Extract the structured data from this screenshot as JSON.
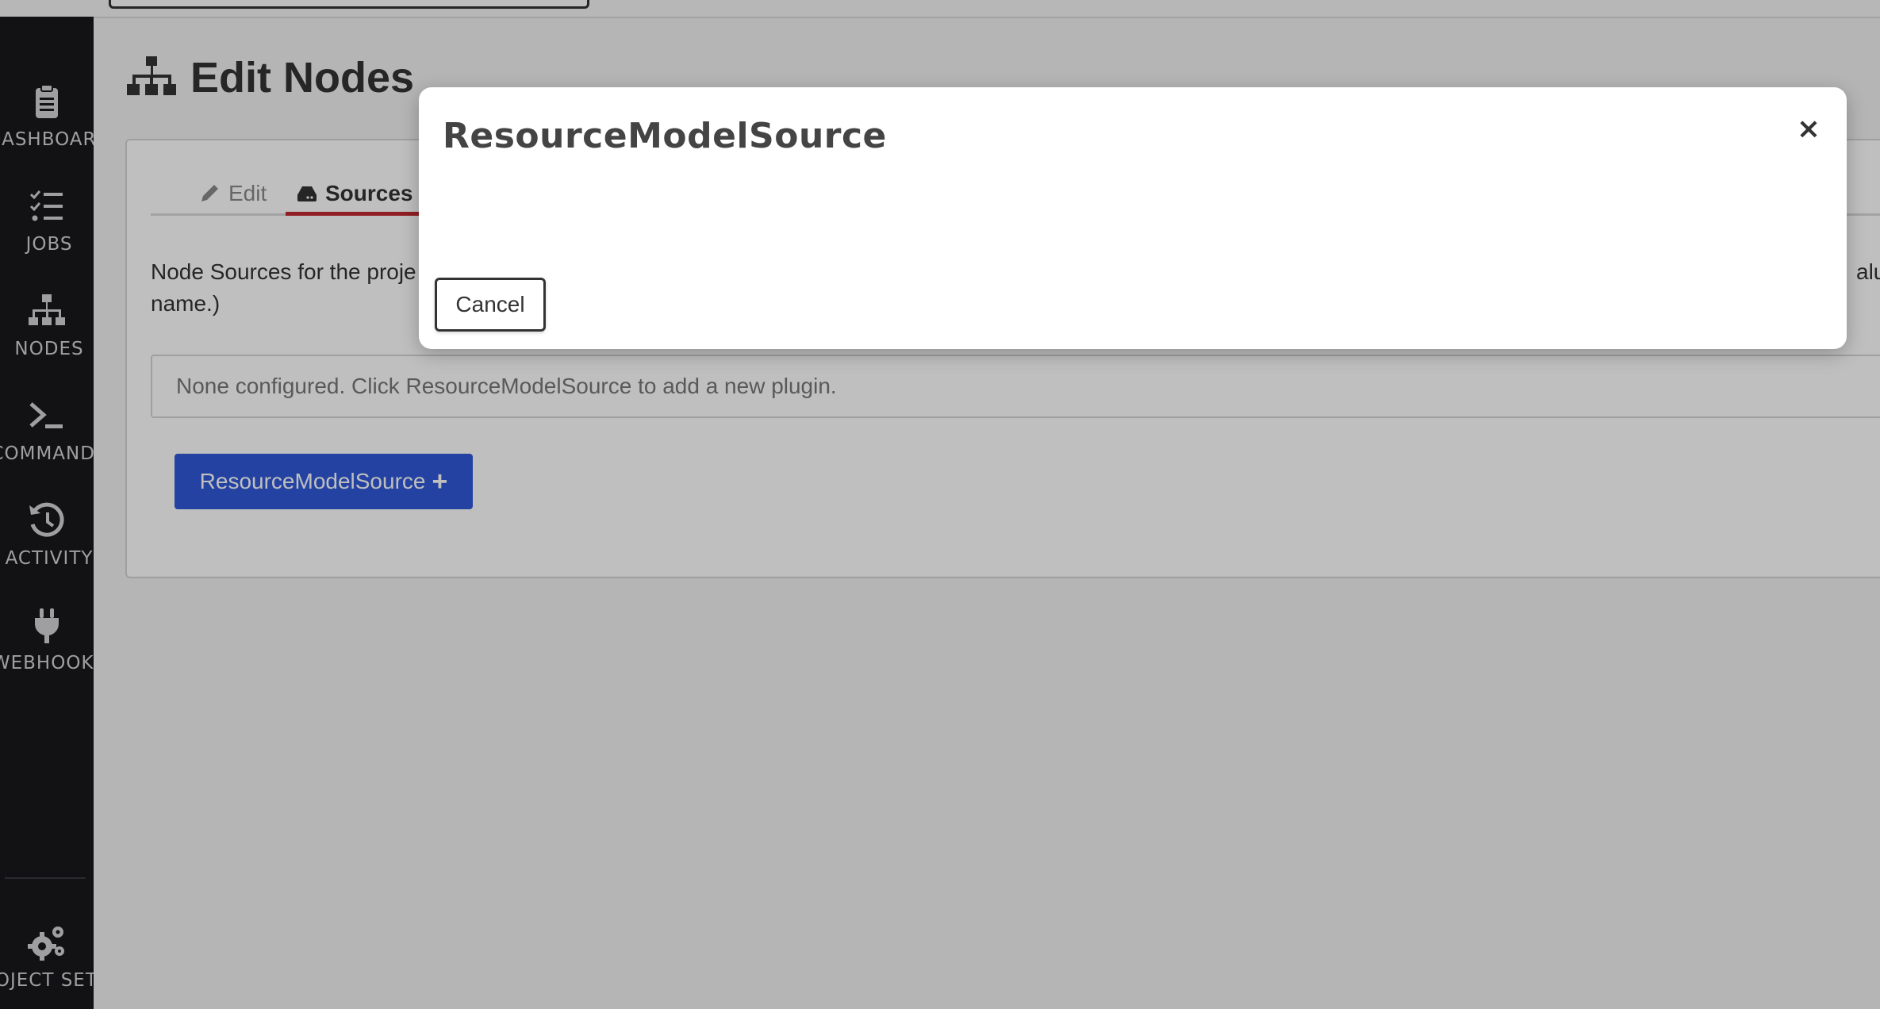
{
  "sidebar": {
    "items": [
      {
        "label": "DASHBOARD",
        "icon": "clipboard-icon"
      },
      {
        "label": "JOBS",
        "icon": "tasks-icon"
      },
      {
        "label": "NODES",
        "icon": "sitemap-icon"
      },
      {
        "label": "COMMANDS",
        "icon": "terminal-icon"
      },
      {
        "label": "ACTIVITY",
        "icon": "history-icon"
      },
      {
        "label": "WEBHOOKS",
        "icon": "plug-icon"
      }
    ],
    "footer": {
      "label": "PROJECT SETTINGS",
      "icon": "gears-icon"
    }
  },
  "page": {
    "title": "Edit Nodes",
    "title_icon": "sitemap-icon"
  },
  "tabs": [
    {
      "label": "Edit",
      "icon": "pencil-icon"
    },
    {
      "label": "Sources",
      "icon": "hdd-icon",
      "active": true
    }
  ],
  "content": {
    "help_text_visible_start": "Node Sources for the proje",
    "help_text_visible_end": "alue",
    "help_text_line2": "name.)",
    "empty_message": "None configured. Click ResourceModelSource to add a new plugin.",
    "add_button_label": "ResourceModelSource",
    "add_button_icon": "plus-icon"
  },
  "modal": {
    "title": "ResourceModelSource",
    "close_symbol": "×",
    "cancel_label": "Cancel"
  },
  "colors": {
    "sidebar_bg": "#18181b",
    "active_tab_underline": "#c0282f",
    "primary_button": "#2f58d8"
  }
}
